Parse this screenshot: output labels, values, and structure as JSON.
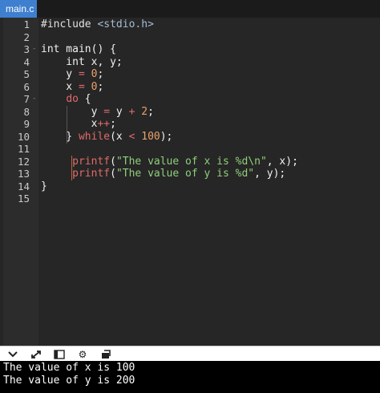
{
  "tab": {
    "label": "main.c"
  },
  "code_lines": [
    {
      "n": "1",
      "fold": "",
      "html": [
        [
          "pp",
          "#include "
        ],
        [
          "inc",
          "<stdio.h>"
        ]
      ]
    },
    {
      "n": "2",
      "fold": "",
      "html": []
    },
    {
      "n": "3",
      "fold": "-",
      "html": [
        [
          "",
          "int main() {"
        ]
      ]
    },
    {
      "n": "4",
      "fold": "",
      "html": [
        [
          "",
          "    int x, y;"
        ]
      ]
    },
    {
      "n": "5",
      "fold": "",
      "html": [
        [
          "",
          "    y "
        ],
        [
          "op",
          "="
        ],
        [
          "",
          " "
        ],
        [
          "num",
          "0"
        ],
        [
          "",
          ";"
        ]
      ]
    },
    {
      "n": "6",
      "fold": "",
      "html": [
        [
          "",
          "    x "
        ],
        [
          "op",
          "="
        ],
        [
          "",
          " "
        ],
        [
          "num",
          "0"
        ],
        [
          "",
          ";"
        ]
      ]
    },
    {
      "n": "7",
      "fold": "-",
      "html": [
        [
          "",
          "    "
        ],
        [
          "kw",
          "do"
        ],
        [
          "",
          " {"
        ]
      ]
    },
    {
      "n": "8",
      "fold": "",
      "html": [
        [
          "",
          "        y "
        ],
        [
          "op",
          "="
        ],
        [
          "",
          " y "
        ],
        [
          "op",
          "+"
        ],
        [
          "",
          " "
        ],
        [
          "num",
          "2"
        ],
        [
          "",
          ";"
        ]
      ]
    },
    {
      "n": "9",
      "fold": "",
      "html": [
        [
          "",
          "        x"
        ],
        [
          "op",
          "++"
        ],
        [
          "",
          ";"
        ]
      ]
    },
    {
      "n": "10",
      "fold": "",
      "html": [
        [
          "",
          "    } "
        ],
        [
          "kw",
          "while"
        ],
        [
          "",
          "(x "
        ],
        [
          "op",
          "<"
        ],
        [
          "",
          " "
        ],
        [
          "num",
          "100"
        ],
        [
          "",
          ");"
        ]
      ]
    },
    {
      "n": "11",
      "fold": "",
      "html": []
    },
    {
      "n": "12",
      "fold": "",
      "html": [
        [
          "",
          "     "
        ],
        [
          "fn",
          "printf"
        ],
        [
          "",
          "("
        ],
        [
          "str",
          "\"The value of x is %d\\n\""
        ],
        [
          "",
          ", x);"
        ]
      ]
    },
    {
      "n": "13",
      "fold": "",
      "html": [
        [
          "",
          "     "
        ],
        [
          "fn",
          "printf"
        ],
        [
          "",
          "("
        ],
        [
          "str",
          "\"The value of y is %d\""
        ],
        [
          "",
          ", y);"
        ]
      ]
    },
    {
      "n": "14",
      "fold": "",
      "html": [
        [
          "",
          "}"
        ]
      ]
    },
    {
      "n": "15",
      "fold": "",
      "html": []
    }
  ],
  "toolbar": {
    "icons": [
      "chevron-down-icon",
      "expand-icon",
      "panel-icon",
      "gear-icon",
      "export-icon"
    ]
  },
  "console": {
    "lines": [
      "The value of x is 100",
      "The value of y is 200"
    ]
  }
}
